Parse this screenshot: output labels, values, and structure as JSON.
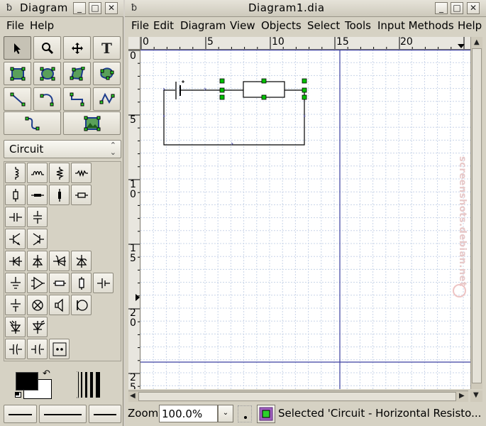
{
  "toolbox": {
    "title": "Diagram",
    "menu": [
      "File",
      "Help"
    ],
    "sheet_selected": "Circuit"
  },
  "diagram_window": {
    "title": "Diagram1.dia",
    "menu": [
      "File",
      "Edit",
      "Diagram",
      "View",
      "Objects",
      "Select",
      "Tools",
      "Input Methods",
      "Help"
    ],
    "ruler_h": [
      "0",
      "5",
      "10",
      "15",
      "20"
    ],
    "ruler_v": [
      "0",
      "5",
      "1\n0",
      "1\n5",
      "2\n0",
      "2\n5"
    ],
    "watermark": "screenshots.debian.net"
  },
  "status": {
    "zoom_label": "Zoom",
    "zoom_value": "100.0%",
    "message": "Selected 'Circuit - Horizontal Resisto..."
  },
  "colors": {
    "grid_line": "#c8d4e8",
    "guide_line": "#3b3fa0",
    "selection_handle": "#00c000",
    "foreground": "#000000",
    "background": "#ffffff"
  },
  "icons": {
    "app": "dia-logo-icon",
    "minimize": "minimize-icon",
    "maximize": "maximize-icon",
    "close": "close-icon"
  }
}
